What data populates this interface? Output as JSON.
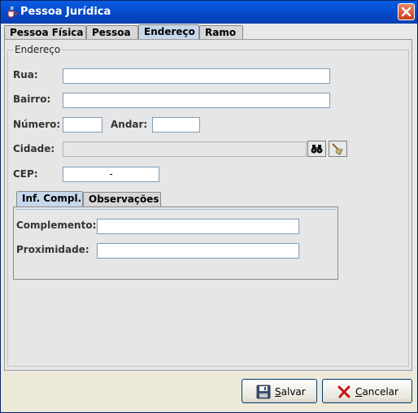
{
  "window": {
    "title": "Pessoa Jurídica"
  },
  "tabs": [
    {
      "label": "Pessoa Física"
    },
    {
      "label": "Pessoa"
    },
    {
      "label": "Endereço"
    },
    {
      "label": "Ramo"
    }
  ],
  "active_tab": "Endereço",
  "endereco": {
    "legend": "Endereço",
    "rua": {
      "label": "Rua:",
      "value": ""
    },
    "bairro": {
      "label": "Bairro:",
      "value": ""
    },
    "numero": {
      "label": "Número:",
      "value": ""
    },
    "andar": {
      "label": "Andar:",
      "value": ""
    },
    "cidade": {
      "label": "Cidade:",
      "value": ""
    },
    "cep": {
      "label": "CEP:",
      "value": "-"
    }
  },
  "subtabs": [
    {
      "label": "Inf. Compl."
    },
    {
      "label": "Observações"
    }
  ],
  "active_subtab": "Inf. Compl.",
  "inf_compl": {
    "complemento": {
      "label": "Complemento:",
      "value": ""
    },
    "proximidade": {
      "label": "Proximidade:",
      "value": ""
    }
  },
  "buttons": {
    "salvar": {
      "mnemonic": "S",
      "rest": "alvar"
    },
    "cancelar": {
      "mnemonic": "C",
      "rest": "ancelar"
    }
  },
  "icons": {
    "window": "java-cup-icon",
    "close": "close-icon",
    "search_city": "binoculars-icon",
    "clear_city": "broom-icon",
    "save": "floppy-disk-icon",
    "cancel": "red-x-icon"
  }
}
